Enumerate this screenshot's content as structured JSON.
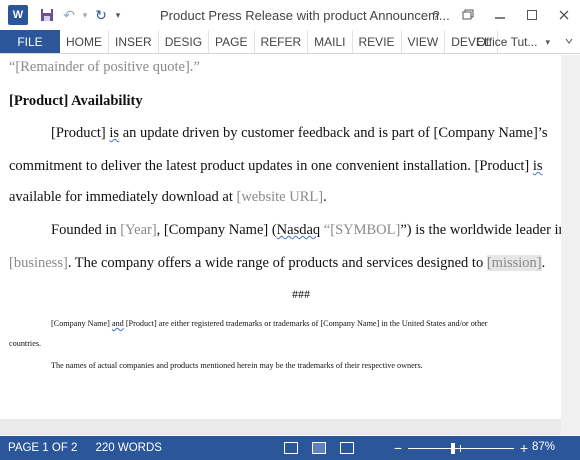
{
  "window": {
    "app_icon": "word-icon",
    "app_icon_letter": "W",
    "title": "Product Press Release with product Announcem...",
    "help_label": "?",
    "controls": [
      "restore-icon",
      "minimize-icon",
      "maximize-icon",
      "close-icon"
    ]
  },
  "ribbon": {
    "file_label": "FILE",
    "tabs": [
      "HOME",
      "INSER",
      "DESIG",
      "PAGE",
      "REFER",
      "MAILI",
      "REVIE",
      "VIEW",
      "DEVEL"
    ],
    "account": "Office Tut..."
  },
  "document": {
    "quote_line": "“[Remainder of positive quote].”",
    "heading": "[Product] Availability",
    "p1": {
      "l1_a": "[Product] ",
      "l1_is": "is",
      "l1_b": " an update driven by customer feedback and is part of [Company Name]’s",
      "l2_a": "commitment to deliver the latest product updates in one convenient installation. [Product] ",
      "l2_is": "is",
      "l3_a": "available for immediately download at ",
      "l3_url": "[website URL]",
      "l3_end": "."
    },
    "p2": {
      "l1_a": "Founded in ",
      "l1_year": "[Year]",
      "l1_b": ", [Company Name] (",
      "l1_nasdaq": "Nasdaq",
      "l1_c": " “",
      "l1_symbol": "[SYMBOL]",
      "l1_d": "”) is the worldwide leader in",
      "l2_business": "[business]",
      "l2_b": ". The company offers a wide range of products and services designed to ",
      "l2_mission": "[mission]",
      "l2_end": "."
    },
    "separator": "###",
    "fine1_a": "[Company Name] ",
    "fine1_and": "and",
    "fine1_b": " [Product] are either registered trademarks or trademarks of [Company Name] in the United States and/or other",
    "fine2": "countries.",
    "fine3": "The names of actual companies and products mentioned herein may be the trademarks of their respective owners."
  },
  "status": {
    "page": "PAGE 1 OF 2",
    "words": "220 WORDS",
    "zoom_pct": "87%",
    "zoom_level": 0.87
  }
}
